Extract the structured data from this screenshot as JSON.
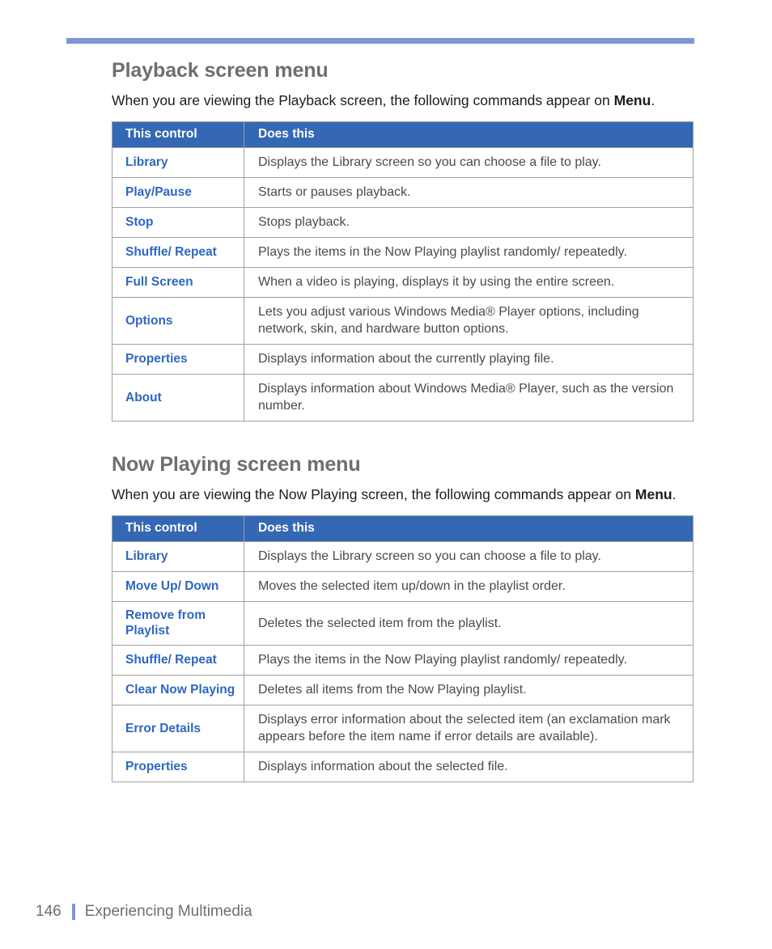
{
  "document": {
    "top_rule_color": "#7e95d6",
    "heading_color": "#6e6e6e",
    "link_color": "#2f67c0",
    "table_header_bg": "#3568b4",
    "table_border_color": "#9fa0a2",
    "body_text_color": "#1d1d1d",
    "description_text_color": "#4b4b4b"
  },
  "sections": [
    {
      "heading": "Playback screen menu",
      "intro_before_bold": "When you are viewing the Playback screen, the following commands appear on ",
      "intro_bold": "Menu",
      "intro_after_bold": ".",
      "table": {
        "headers": {
          "control": "This control",
          "description": "Does this"
        },
        "rows": [
          {
            "control": "Library",
            "description": "Displays the Library screen so you can choose a file to play."
          },
          {
            "control": "Play/Pause",
            "description": "Starts or pauses playback."
          },
          {
            "control": "Stop",
            "description": "Stops playback."
          },
          {
            "control": "Shuffle/ Repeat",
            "description": "Plays the items in the Now Playing playlist randomly/ repeatedly."
          },
          {
            "control": "Full Screen",
            "description": "When a video is playing, displays it by using the entire screen."
          },
          {
            "control": "Options",
            "description": "Lets you adjust various Windows Media® Player options, including network, skin, and hardware button options."
          },
          {
            "control": "Properties",
            "description": "Displays information about the currently playing file."
          },
          {
            "control": "About",
            "description": "Displays information about Windows Media® Player, such as the version number."
          }
        ]
      }
    },
    {
      "heading": "Now Playing screen menu",
      "intro_before_bold": "When you are viewing the Now Playing screen, the following commands appear on ",
      "intro_bold": "Menu",
      "intro_after_bold": ".",
      "table": {
        "headers": {
          "control": "This control",
          "description": "Does this"
        },
        "rows": [
          {
            "control": "Library",
            "description": "Displays the Library screen so you can choose a file to play."
          },
          {
            "control": "Move Up/ Down",
            "description": "Moves the selected item up/down in the playlist order."
          },
          {
            "control": "Remove from Playlist",
            "description": "Deletes the selected item from the playlist."
          },
          {
            "control": "Shuffle/ Repeat",
            "description": "Plays the items in the Now Playing playlist randomly/ repeatedly."
          },
          {
            "control": "Clear Now Playing",
            "description": "Deletes all items from the Now Playing playlist."
          },
          {
            "control": "Error Details",
            "description": "Displays error information about the selected item (an exclamation mark appears before the item name if error details are available)."
          },
          {
            "control": "Properties",
            "description": "Displays information about the selected file."
          }
        ]
      }
    }
  ],
  "footer": {
    "page_number": "146",
    "title": "Experiencing Multimedia"
  }
}
